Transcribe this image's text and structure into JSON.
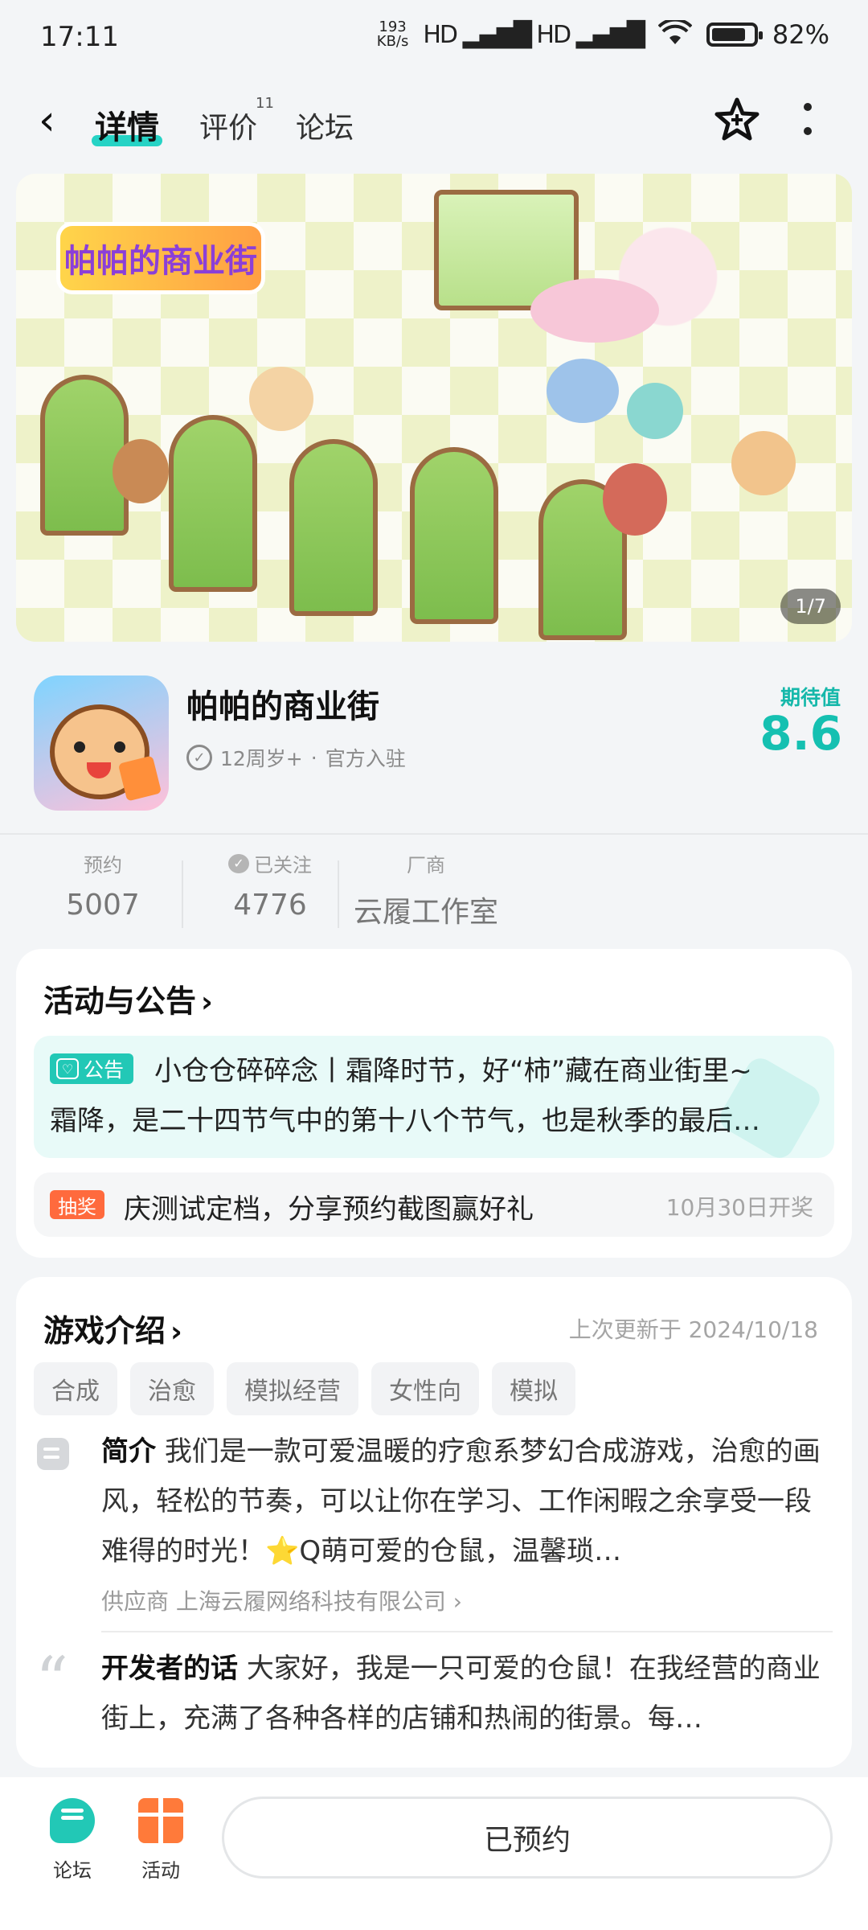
{
  "status_bar": {
    "time": "17:11",
    "net_speed_value": "193",
    "net_speed_unit": "KB/s",
    "signal_text": "HD ▂▄▆█ HD ▂▄▆█",
    "battery_percent": 82,
    "battery_label": "82%"
  },
  "nav": {
    "tabs": [
      {
        "label": "详情",
        "active": true
      },
      {
        "label": "评价",
        "badge": "11"
      },
      {
        "label": "论坛"
      }
    ],
    "icons": [
      "back-icon",
      "star-icon",
      "more-icon"
    ]
  },
  "banner": {
    "logo_text": "帕帕的商业街",
    "counter": "1/7"
  },
  "app": {
    "name": "帕帕的商业街",
    "age_rating": "12周岁+",
    "official": "官方入驻",
    "meta_sep": "·",
    "expect_label": "期待值",
    "expect_value": "8.6"
  },
  "stats": {
    "reserve": {
      "label": "预约",
      "value": "5007"
    },
    "follow": {
      "label": "已关注",
      "value": "4776"
    },
    "maker": {
      "label": "厂商",
      "value": "云履工作室"
    }
  },
  "activity": {
    "title": "活动与公告",
    "chevron": "›",
    "notice": {
      "tag": "公告",
      "line1": "小仓仓碎碎念丨霜降时节，好“柿”藏在商业街里~",
      "line2": "霜降，是二十四节气中的第十八个节气，也是秋季的最后…"
    },
    "lottery": {
      "tag": "抽奖",
      "text": "庆测试定档，分享预约截图赢好礼",
      "date": "10月30日开奖"
    }
  },
  "intro": {
    "title": "游戏介绍",
    "chevron": "›",
    "updated": "上次更新于 2024/10/18",
    "tags": [
      "合成",
      "治愈",
      "模拟经营",
      "女性向",
      "模拟"
    ],
    "summary_label": "简介",
    "summary_text": "我们是一款可爱温暖的疗愈系梦幻合成游戏，治愈的画风，轻松的节奏，可以让你在学习、工作闲暇之余享受一段难得的时光！⭐Q萌可爱的仓鼠，温馨琐…",
    "supplier": "供应商 上海云履网络科技有限公司 ›",
    "dev_label": "开发者的话",
    "dev_text": "大家好，我是一只可爱的仓鼠！在我经营的商业街上，充满了各种各样的店铺和热闹的街景。每…"
  },
  "bottom": {
    "forum": "论坛",
    "activity": "活动",
    "reserve_button": "已预约"
  },
  "colors": {
    "accent": "#22c8b6",
    "lottery": "#ff6a3d",
    "background": "#f3f5f7"
  }
}
